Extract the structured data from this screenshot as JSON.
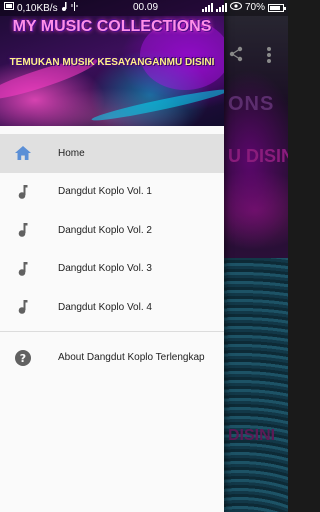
{
  "status_bar": {
    "net_speed": "0,10KB/s",
    "time": "00.09",
    "battery": "70%"
  },
  "drawer": {
    "header_title": "MY MUSIC COLLECTIONS",
    "header_subtitle": "TEMUKAN MUSIK KESAYANGANMU DISINI",
    "items": [
      {
        "label": "Home",
        "icon": "home-icon",
        "active": true
      },
      {
        "label": "Dangdut Koplo Vol. 1",
        "icon": "music-note-icon"
      },
      {
        "label": "Dangdut Koplo Vol. 2",
        "icon": "music-note-icon"
      },
      {
        "label": "Dangdut Koplo Vol. 3",
        "icon": "music-note-icon"
      },
      {
        "label": "Dangdut Koplo Vol. 4",
        "icon": "music-note-icon"
      }
    ],
    "about": {
      "label": "About Dangdut Koplo Terlengkap",
      "icon": "help-icon"
    }
  },
  "background": {
    "headline_1": "ONS",
    "headline_2": "U DISINI",
    "headline_3": "DISINI"
  },
  "colors": {
    "home_icon": "#5b8fd6",
    "menu_icon": "#616161",
    "active_bg": "#e0e0e0"
  }
}
